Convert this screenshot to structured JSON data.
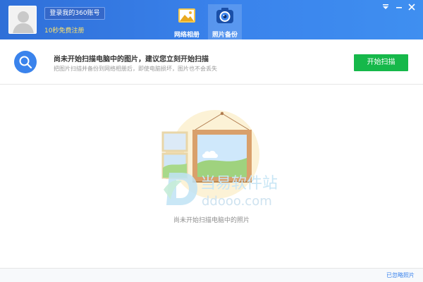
{
  "account": {
    "login_button": "登录我的360账号",
    "register_link": "10秒免费注册"
  },
  "tabs": [
    {
      "label": "网络相册",
      "icon": "photo-album-icon",
      "active": false
    },
    {
      "label": "照片备份",
      "icon": "camera-icon",
      "active": true
    }
  ],
  "window_controls": [
    "menu-icon",
    "minimize-icon",
    "close-icon"
  ],
  "scan": {
    "title": "尚未开始扫描电脑中的图片，建议您立刻开始扫描",
    "subtitle": "把图片扫描并备份到网络相册后，即使电脑损坏，图片也不会丢失",
    "button": "开始扫描"
  },
  "main": {
    "empty_caption": "尚未开始扫描电脑中的照片"
  },
  "watermark": {
    "name": "当易软件站",
    "url": "ddooo.com"
  },
  "footer": {
    "ignored_link": "已忽略照片"
  },
  "colors": {
    "header_blue": "#3a83ec",
    "scan_button_green": "#16b84a",
    "register_yellow": "#ffe36b"
  }
}
